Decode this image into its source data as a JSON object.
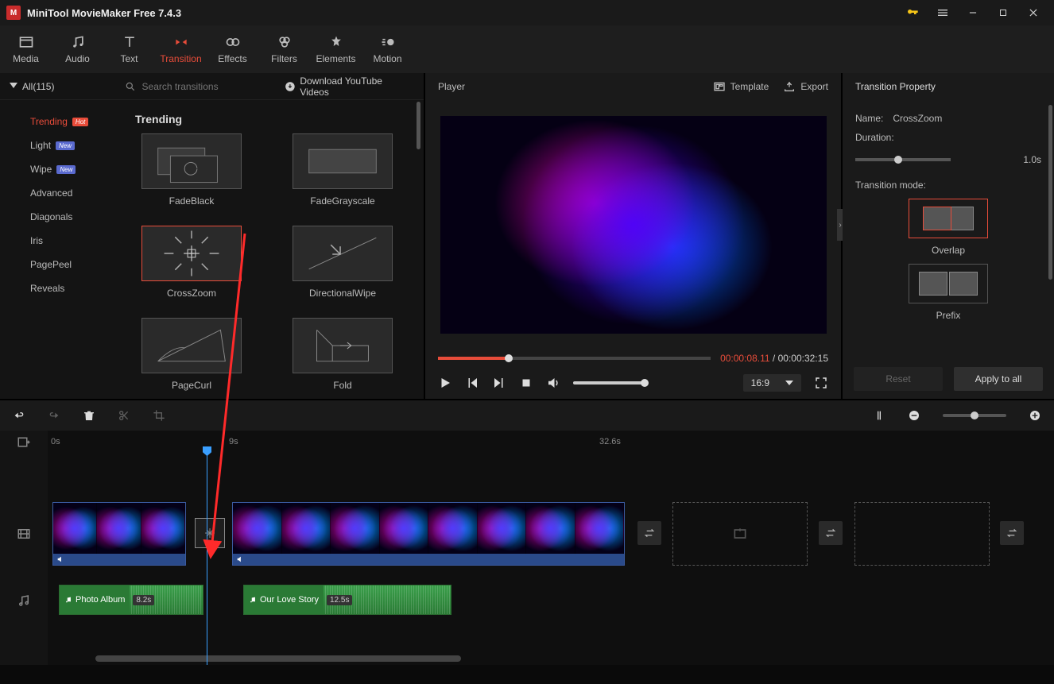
{
  "app": {
    "title": "MiniTool MovieMaker Free 7.4.3"
  },
  "toolbar": {
    "tabs": [
      "Media",
      "Audio",
      "Text",
      "Transition",
      "Effects",
      "Filters",
      "Elements",
      "Motion"
    ],
    "active": "Transition"
  },
  "filter": {
    "all_label": "All(115)",
    "search_placeholder": "Search transitions",
    "download_label": "Download YouTube Videos"
  },
  "sidebar": {
    "items": [
      {
        "label": "Trending",
        "badge": "Hot",
        "active": true
      },
      {
        "label": "Light",
        "badge": "New"
      },
      {
        "label": "Wipe",
        "badge": "New"
      },
      {
        "label": "Advanced"
      },
      {
        "label": "Diagonals"
      },
      {
        "label": "Iris"
      },
      {
        "label": "PagePeel"
      },
      {
        "label": "Reveals"
      }
    ]
  },
  "grid": {
    "heading": "Trending",
    "items": [
      {
        "label": "FadeBlack"
      },
      {
        "label": "FadeGrayscale"
      },
      {
        "label": "CrossZoom",
        "selected": true
      },
      {
        "label": "DirectionalWipe"
      },
      {
        "label": "PageCurl"
      },
      {
        "label": "Fold"
      }
    ]
  },
  "player": {
    "title": "Player",
    "template_label": "Template",
    "export_label": "Export",
    "time_current": "00:00:08.11",
    "time_total": "00:00:32:15",
    "aspect": "16:9"
  },
  "props": {
    "title": "Transition Property",
    "name_label": "Name:",
    "name_value": "CrossZoom",
    "duration_label": "Duration:",
    "duration_value": "1.0s",
    "mode_label": "Transition mode:",
    "modes": [
      {
        "label": "Overlap",
        "selected": true
      },
      {
        "label": "Prefix"
      }
    ],
    "reset_label": "Reset",
    "apply_label": "Apply to all"
  },
  "timeline": {
    "ruler": {
      "t0": "0s",
      "t1": "9s",
      "t2": "32.6s"
    },
    "audio": [
      {
        "name": "Photo Album",
        "dur": "8.2s"
      },
      {
        "name": "Our Love Story",
        "dur": "12.5s"
      }
    ]
  }
}
